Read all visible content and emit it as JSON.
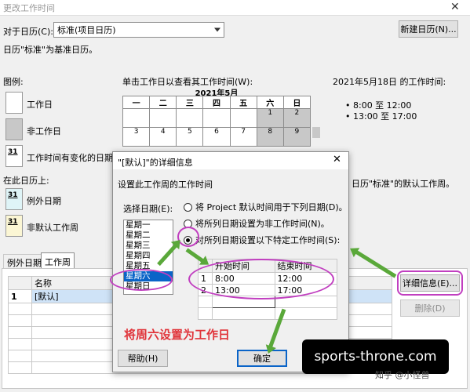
{
  "window": {
    "title": "更改工作时间"
  },
  "for_calendar": {
    "label": "对于日历(C):",
    "value": "标准(项目日历)",
    "new_button": "新建日历(N)..."
  },
  "base_note": "日历\"标准\"为基准日历。",
  "legend": {
    "title": "图例:",
    "items": [
      "工作日",
      "非工作日",
      "工作时间有变化的日期"
    ],
    "on_this_calendar": "在此日历上:",
    "calendar_items": [
      "例外日期",
      "非默认工作周"
    ],
    "badge": "31"
  },
  "calendar": {
    "hint": "单击工作日以查看其工作时间(W):",
    "month": "2021年5月",
    "weekdays": [
      "一",
      "二",
      "三",
      "四",
      "五",
      "六",
      "日"
    ],
    "rows": [
      [
        "",
        "",
        "",
        "",
        "",
        "1",
        "2"
      ],
      [
        "3",
        "4",
        "5",
        "6",
        "7",
        "8",
        "9"
      ]
    ]
  },
  "work_times": {
    "heading": "2021年5月18日 的工作时间:",
    "slots": [
      "• 8:00 至 12:00",
      "• 13:00 至 17:00"
    ]
  },
  "right_note_1": "日历\"标准\"的默认工作周。",
  "tabs": [
    "例外日期",
    "工作周"
  ],
  "week_grid": {
    "header": "名称",
    "rows": [
      {
        "index": "1",
        "name": "[默认]"
      }
    ]
  },
  "side_buttons": {
    "details": "详细信息(E)...",
    "delete": "删除(D)"
  },
  "dialog": {
    "title": "\"[默认]\"的详细信息",
    "section": "设置此工作周的工作时间",
    "select_days_label": "选择日期(E):",
    "days": [
      "星期一",
      "星期二",
      "星期三",
      "星期四",
      "星期五",
      "星期六",
      "星期日"
    ],
    "radio_1": "将 Project 默认时间用于下列日期(D)。",
    "radio_2": "将所列日期设置为非工作时间(N)。",
    "radio_3": "对所列日期设置以下特定工作时间(S):",
    "col_start": "开始时间",
    "col_end": "结束时间",
    "times": [
      {
        "index": "1",
        "start": "8:00",
        "end": "12:00"
      },
      {
        "index": "2",
        "start": "13:00",
        "end": "17:00"
      }
    ],
    "annotation": "将周六设置为工作日",
    "help_button": "帮助(H)",
    "ok_button": "确定"
  },
  "watermark": {
    "site": "sports-throne.com",
    "zhihu": "知乎 @小怪兽"
  },
  "colors": {
    "annotation_red": "#e0343a",
    "ellipse_purple": "#c13fc0",
    "arrow_green": "#5aa83a",
    "selection_blue": "#0a64c8"
  }
}
